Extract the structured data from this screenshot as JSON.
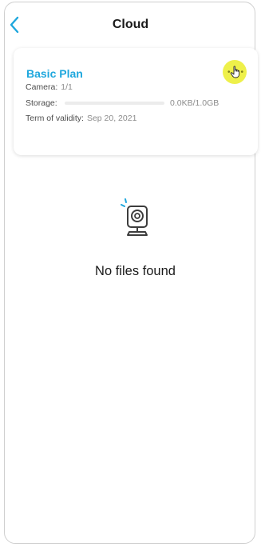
{
  "header": {
    "title": "Cloud",
    "back_icon": "chevron-left-icon"
  },
  "plan_card": {
    "plan_name": "Basic Plan",
    "more_icon": "more-dots-icon",
    "camera_label": "Camera:",
    "camera_value": "1/1",
    "storage_label": "Storage:",
    "storage_value": "0.0KB/1.0GB",
    "storage_used_fraction": 0,
    "validity_label": "Term of validity:",
    "validity_value": "Sep 20, 2021"
  },
  "empty_state": {
    "icon": "camera-icon",
    "message": "No files found"
  },
  "colors": {
    "accent": "#1ea7dd",
    "highlight": "#eef04a",
    "text_primary": "#1a1a1a",
    "text_secondary": "#8c8c8c"
  }
}
